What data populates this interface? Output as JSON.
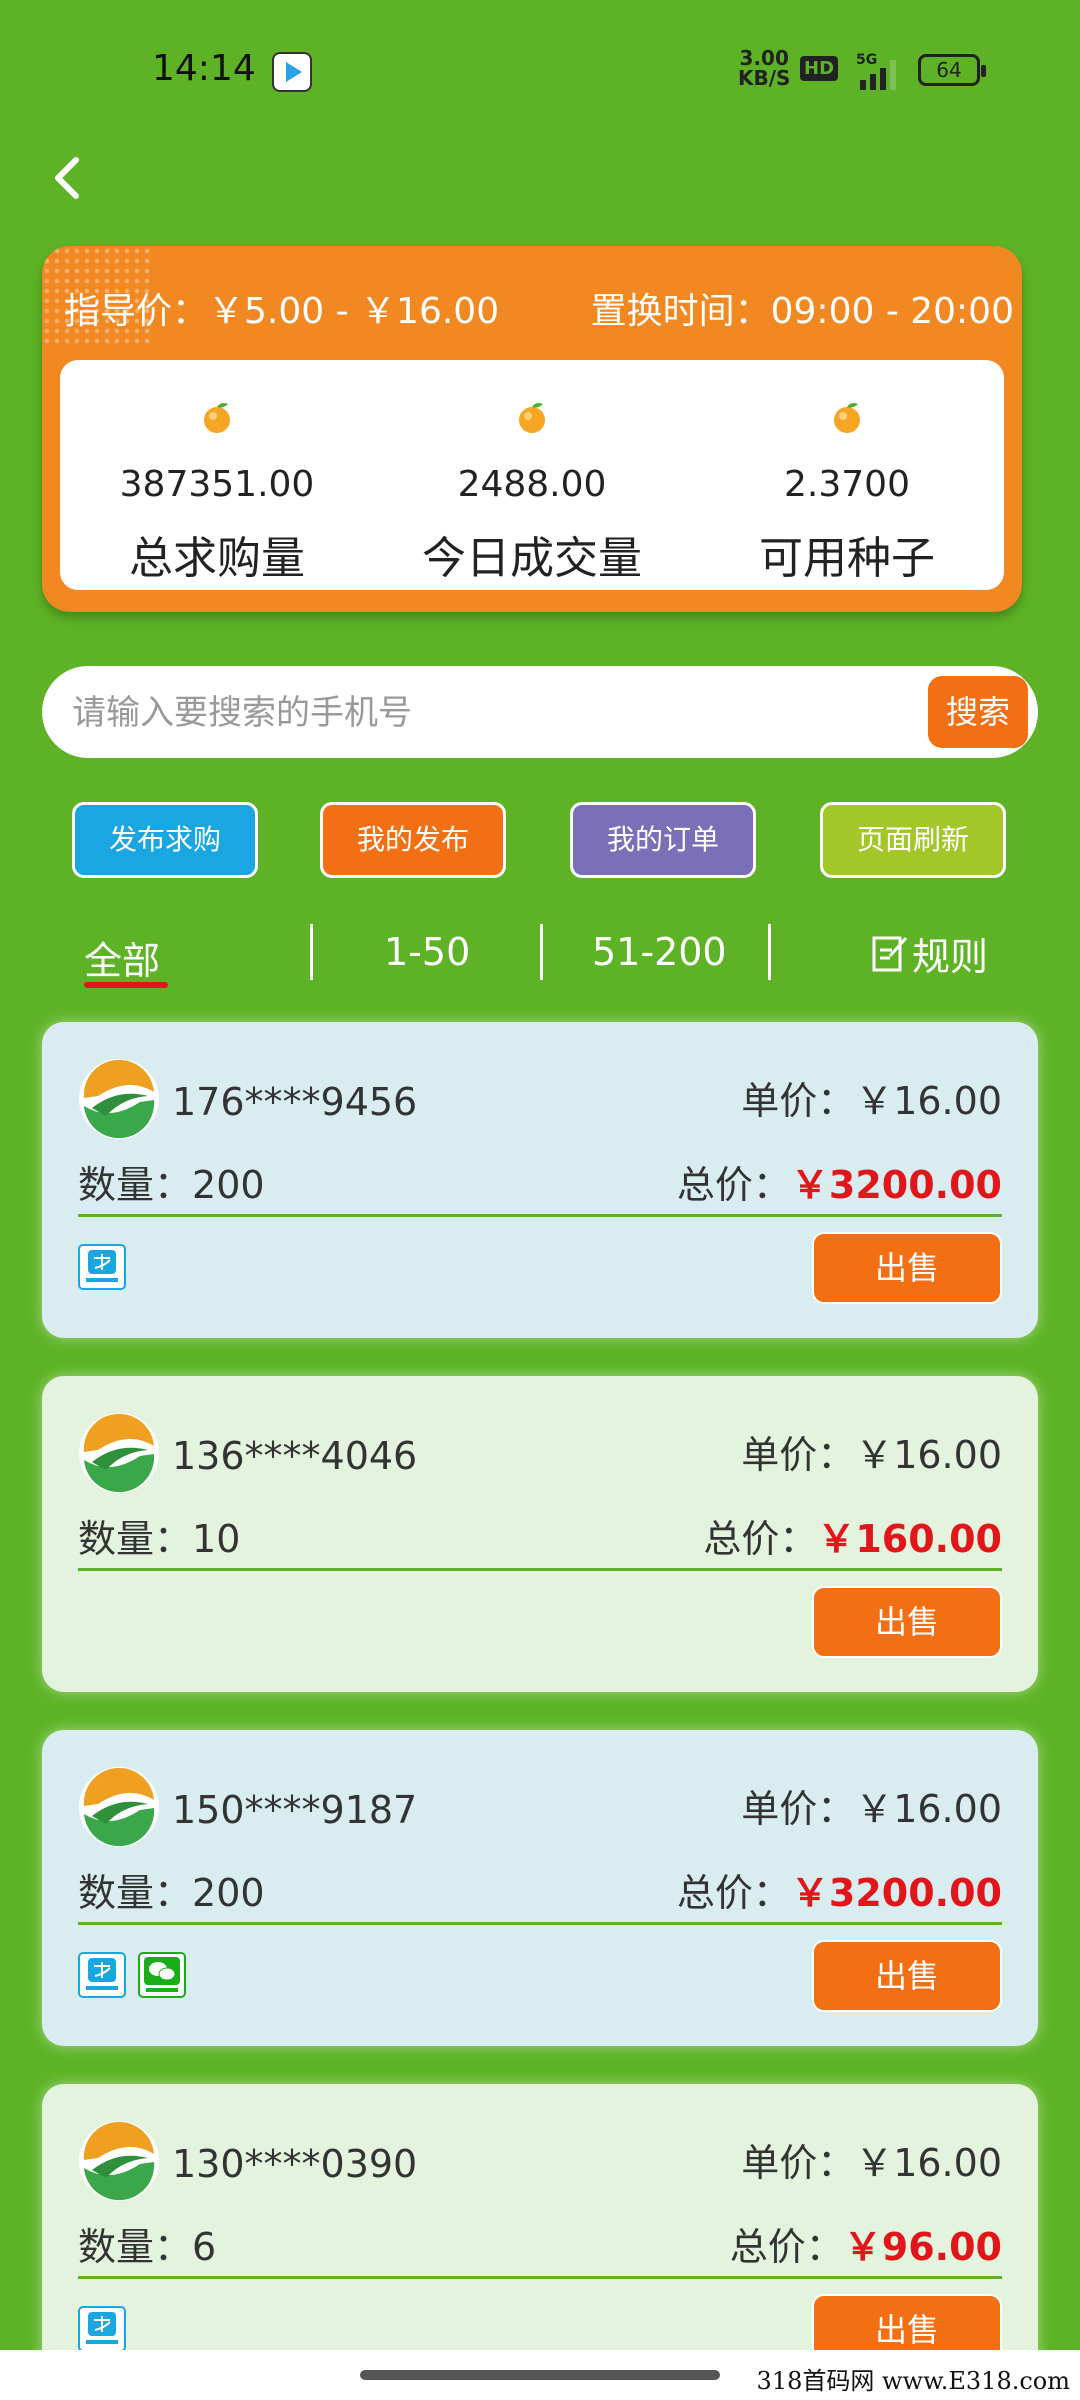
{
  "status_bar": {
    "time": "14:14",
    "speed_value": "3.00",
    "speed_unit": "KB/S",
    "hd": "HD",
    "network": "5G",
    "battery": "64"
  },
  "info": {
    "guide_price": "指导价：￥5.00 - ￥16.00",
    "exchange_time": "置换时间：09:00 - 20:00",
    "stats": [
      {
        "value": "387351.00",
        "label": "总求购量"
      },
      {
        "value": "2488.00",
        "label": "今日成交量"
      },
      {
        "value": "2.3700",
        "label": "可用种子"
      }
    ]
  },
  "search": {
    "placeholder": "请输入要搜索的手机号",
    "button": "搜索"
  },
  "actions": {
    "publish": "发布求购",
    "my_publish": "我的发布",
    "my_orders": "我的订单",
    "refresh": "页面刷新"
  },
  "tabs": {
    "all": "全部",
    "range1": "1-50",
    "range2": "51-200",
    "rules": "规则"
  },
  "orders": [
    {
      "phone": "176****9456",
      "unit_label": "单价：",
      "unit_price": "￥16.00",
      "qty_label": "数量：",
      "qty": "200",
      "total_label": "总价：",
      "total": "￥3200.00",
      "sell": "出售",
      "payments": [
        "alipay"
      ]
    },
    {
      "phone": "136****4046",
      "unit_label": "单价：",
      "unit_price": "￥16.00",
      "qty_label": "数量：",
      "qty": "10",
      "total_label": "总价：",
      "total": "￥160.00",
      "sell": "出售",
      "payments": []
    },
    {
      "phone": "150****9187",
      "unit_label": "单价：",
      "unit_price": "￥16.00",
      "qty_label": "数量：",
      "qty": "200",
      "total_label": "总价：",
      "total": "￥3200.00",
      "sell": "出售",
      "payments": [
        "alipay",
        "wechat"
      ]
    },
    {
      "phone": "130****0390",
      "unit_label": "单价：",
      "unit_price": "￥16.00",
      "qty_label": "数量：",
      "qty": "6",
      "total_label": "总价：",
      "total": "￥96.00",
      "sell": "出售",
      "payments": [
        "alipay"
      ]
    }
  ],
  "colors": {
    "background": "#5db325",
    "accent_orange": "#f36f14",
    "price_red": "#e0161b"
  },
  "watermark": "318首码网 www.E318.com"
}
